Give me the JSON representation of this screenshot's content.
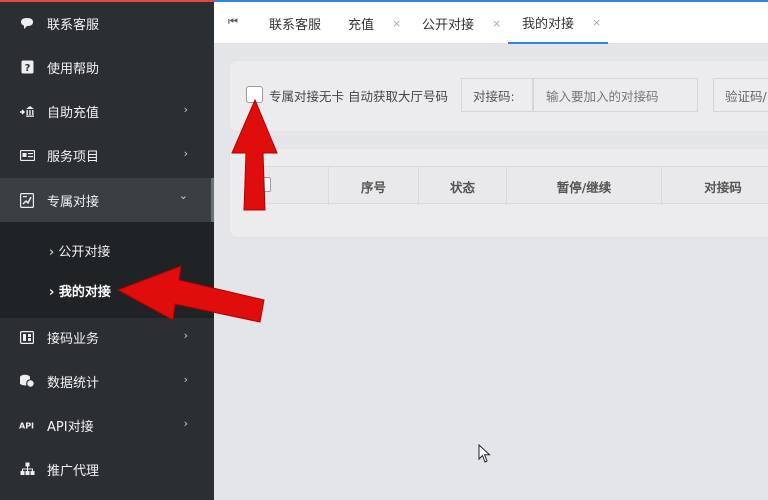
{
  "sidebar": {
    "items": [
      {
        "label": "联系客服",
        "icon": "chat-icon",
        "has_chevron": false
      },
      {
        "label": "使用帮助",
        "icon": "help-icon",
        "has_chevron": false
      },
      {
        "label": "自助充值",
        "icon": "recharge-icon",
        "has_chevron": true
      },
      {
        "label": "服务项目",
        "icon": "service-card-icon",
        "has_chevron": true
      },
      {
        "label": "专属对接",
        "icon": "exclusive-link-icon",
        "has_chevron": true,
        "expanded": true
      },
      {
        "label": "接码业务",
        "icon": "code-business-icon",
        "has_chevron": true
      },
      {
        "label": "数据统计",
        "icon": "stats-coins-icon",
        "has_chevron": true
      },
      {
        "label": "API对接",
        "icon": "api-icon",
        "has_chevron": true
      },
      {
        "label": "推广代理",
        "icon": "org-chart-icon",
        "has_chevron": false
      }
    ],
    "submenu": [
      {
        "label": "公开对接"
      },
      {
        "label": "我的对接",
        "current": true
      }
    ],
    "chevron_right": "›",
    "chevron_down": "⌄",
    "sub_prefix": "›"
  },
  "tabs": {
    "first_icon": "⏮",
    "items": [
      {
        "label": "联系客服",
        "closable": false
      },
      {
        "label": "充值",
        "closable": true
      },
      {
        "label": "公开对接",
        "closable": true
      },
      {
        "label": "我的对接",
        "closable": true,
        "active": true
      }
    ],
    "close_glyph": "×"
  },
  "filters": {
    "checkbox_label": "专属对接无卡 自动获取大厅号码",
    "code_label": "对接码:",
    "code_placeholder": "输入要加入的对接码",
    "verify_placeholder": "验证码/"
  },
  "table": {
    "headers": [
      "序号",
      "状态",
      "暂停/继续",
      "对接码"
    ]
  },
  "colors": {
    "sidebar_bg": "#2b2f33",
    "accent": "#2f86e0",
    "arrow": "#e00d0d"
  }
}
